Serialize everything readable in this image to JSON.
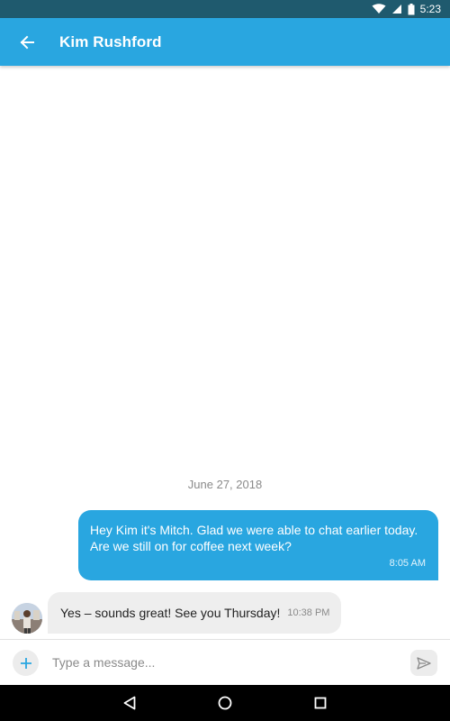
{
  "status_bar": {
    "time": "5:23",
    "icons": [
      "wifi-icon",
      "signal-icon",
      "battery-icon"
    ]
  },
  "header": {
    "title": "Kim Rushford",
    "back_icon": "arrow-back-icon"
  },
  "conversation": {
    "date": "June 27, 2018",
    "messages": [
      {
        "direction": "outgoing",
        "text_line1": "Hey Kim it's Mitch. Glad we were able to chat earlier today.",
        "text_line2": "Are we still on for coffee next week?",
        "time": "8:05 AM"
      },
      {
        "direction": "incoming",
        "text": "Yes – sounds great! See you Thursday!",
        "time": "10:38 PM"
      }
    ]
  },
  "composer": {
    "placeholder": "Type a message...",
    "value": "",
    "add_icon": "plus-icon",
    "send_icon": "send-icon"
  },
  "nav_bar": {
    "icons": [
      "back-triangle-icon",
      "home-circle-icon",
      "recents-square-icon"
    ]
  },
  "colors": {
    "accent": "#29a6e0",
    "status_bar": "#1f5a6e",
    "incoming_bubble": "#eeeeee",
    "nav_bar": "#000000"
  }
}
